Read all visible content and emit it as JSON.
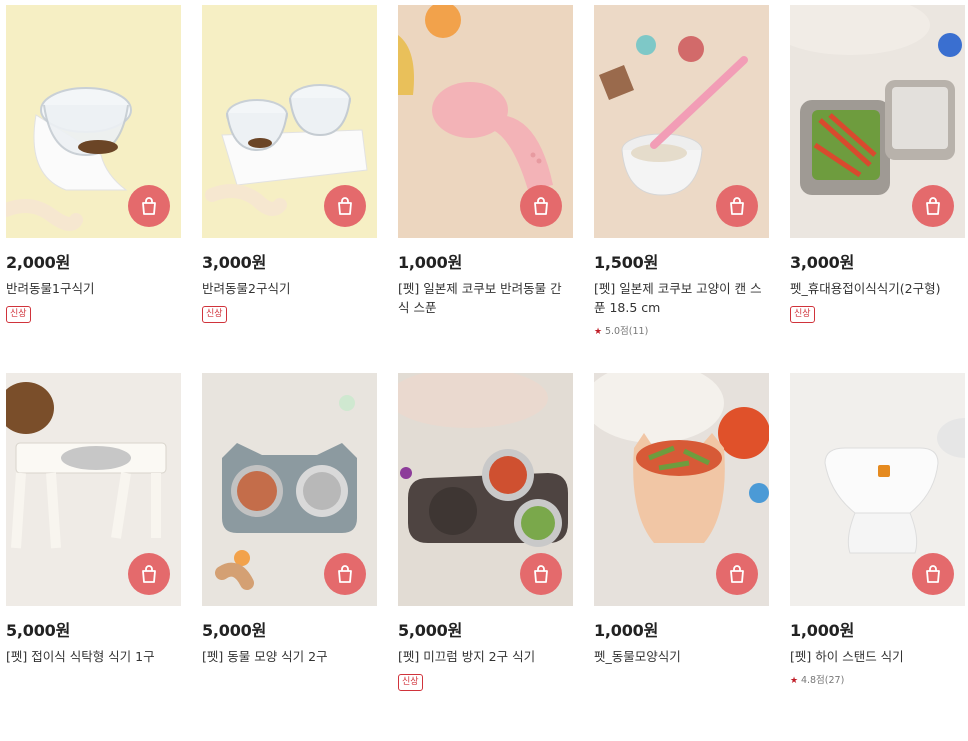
{
  "colors": {
    "cart_button": "#e46a6c",
    "badge": "#d0333b",
    "star": "#c01d27"
  },
  "products": [
    {
      "price": "2,000원",
      "name": "반려동물1구식기",
      "badge": "신상",
      "rating": "",
      "image": "clear-single-bowl-yellow-bg"
    },
    {
      "price": "3,000원",
      "name": "반려동물2구식기",
      "badge": "신상",
      "rating": "",
      "image": "clear-double-bowl-yellow-bg"
    },
    {
      "price": "1,000원",
      "name": "[펫] 일본제 코쿠보 반려동물 간식 스푼",
      "badge": "",
      "rating": "",
      "image": "pink-spoon-beige-bg"
    },
    {
      "price": "1,500원",
      "name": "[펫] 일본제 코쿠보 고양이 캔 스푼 18.5 cm",
      "badge": "",
      "rating": "5.0점(11)",
      "image": "pink-can-spoon"
    },
    {
      "price": "3,000원",
      "name": "펫_휴대용접이식식기(2구형)",
      "badge": "신상",
      "rating": "",
      "image": "gray-foldable-bowl"
    },
    {
      "price": "5,000원",
      "name": "[펫] 접이식 식탁형 식기 1구",
      "badge": "",
      "rating": "",
      "image": "white-table-bowl"
    },
    {
      "price": "5,000원",
      "name": "[펫] 동물 모양 식기 2구",
      "badge": "",
      "rating": "",
      "image": "gray-cat-shaped-tray"
    },
    {
      "price": "5,000원",
      "name": "[펫] 미끄럼 방지 2구 식기",
      "badge": "신상",
      "rating": "",
      "image": "brown-antislip-tray"
    },
    {
      "price": "1,000원",
      "name": "펫_동물모양식기",
      "badge": "",
      "rating": "",
      "image": "peach-cat-ear-bowl"
    },
    {
      "price": "1,000원",
      "name": "[펫] 하이 스탠드 식기",
      "badge": "",
      "rating": "4.8점(27)",
      "image": "white-high-stand-bowl"
    }
  ]
}
